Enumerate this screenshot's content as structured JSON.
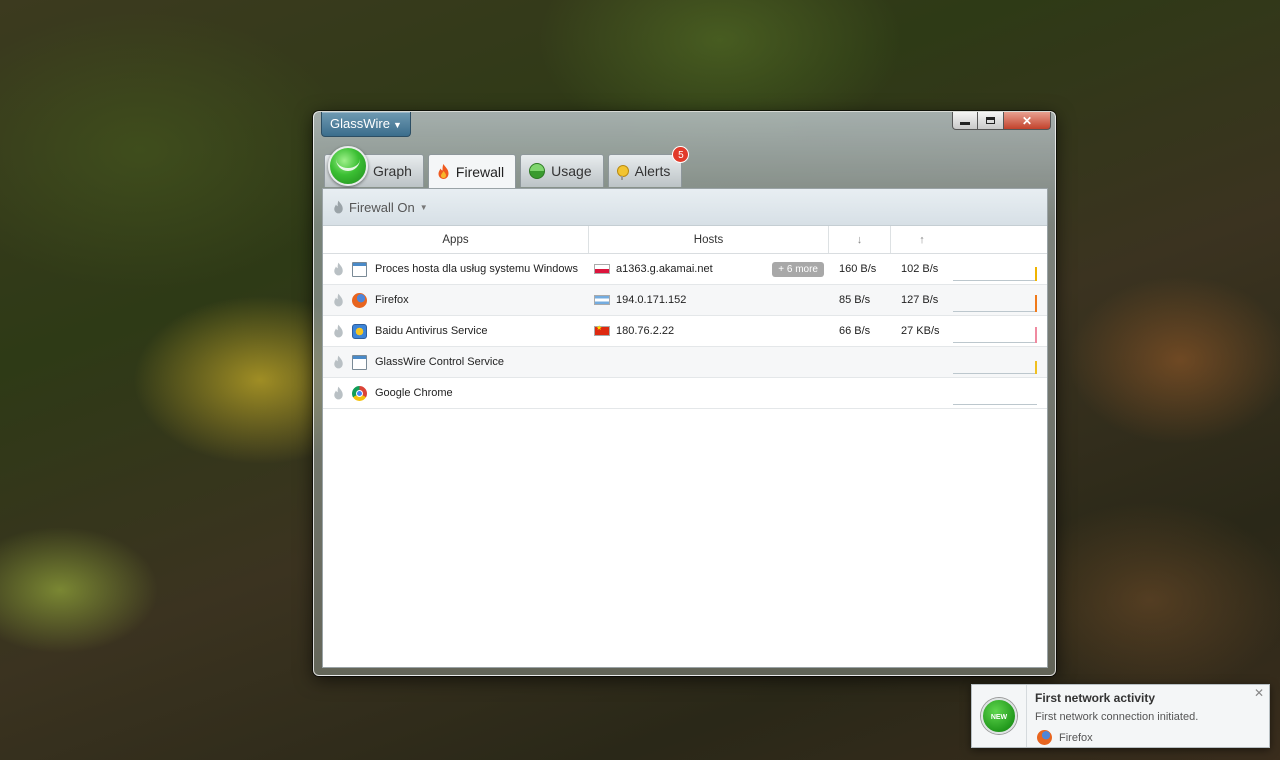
{
  "app": {
    "name": "GlassWire"
  },
  "tabs": [
    {
      "label": "Graph",
      "icon": "graph-icon"
    },
    {
      "label": "Firewall",
      "icon": "flame-icon"
    },
    {
      "label": "Usage",
      "icon": "usage-icon"
    },
    {
      "label": "Alerts",
      "icon": "bulb-icon",
      "badge": "5"
    }
  ],
  "active_tab": "Firewall",
  "toolbar": {
    "firewall_label": "Firewall On"
  },
  "table": {
    "columns": [
      "Apps",
      "Hosts",
      "↓",
      "↑"
    ],
    "rows": [
      {
        "app": "Proces hosta dla usług systemu Windows",
        "icon": "window-icon",
        "flag": "pl",
        "host": "a1363.g.akamai.net",
        "more": "+ 6 more",
        "down": "160 B/s",
        "up": "102 B/s",
        "spark_level": 0.6,
        "spark_color": "#f0b400"
      },
      {
        "app": "Firefox",
        "icon": "firefox-icon",
        "flag": "ar",
        "host": "194.0.171.152",
        "more": "",
        "down": "85 B/s",
        "up": "127 B/s",
        "spark_level": 0.7,
        "spark_color": "#f07a1a"
      },
      {
        "app": "Baidu Antivirus Service",
        "icon": "baidu-icon",
        "flag": "cn",
        "host": "180.76.2.22",
        "more": "",
        "down": "66 B/s",
        "up": "27 KB/s",
        "spark_level": 0.65,
        "spark_color": "#f08aa0"
      },
      {
        "app": "GlassWire Control Service",
        "icon": "window-icon",
        "flag": "",
        "host": "",
        "more": "",
        "down": "",
        "up": "",
        "spark_level": 0.55,
        "spark_color": "#f0c020"
      },
      {
        "app": "Google Chrome",
        "icon": "chrome-icon",
        "flag": "",
        "host": "",
        "more": "",
        "down": "",
        "up": "",
        "spark_level": 0,
        "spark_color": "#bcc7cd"
      }
    ]
  },
  "notification": {
    "badge": "NEW",
    "title": "First network activity",
    "subtitle": "First network connection initiated.",
    "app": "Firefox",
    "close": "✕"
  },
  "window_controls": {
    "close": "✕"
  }
}
